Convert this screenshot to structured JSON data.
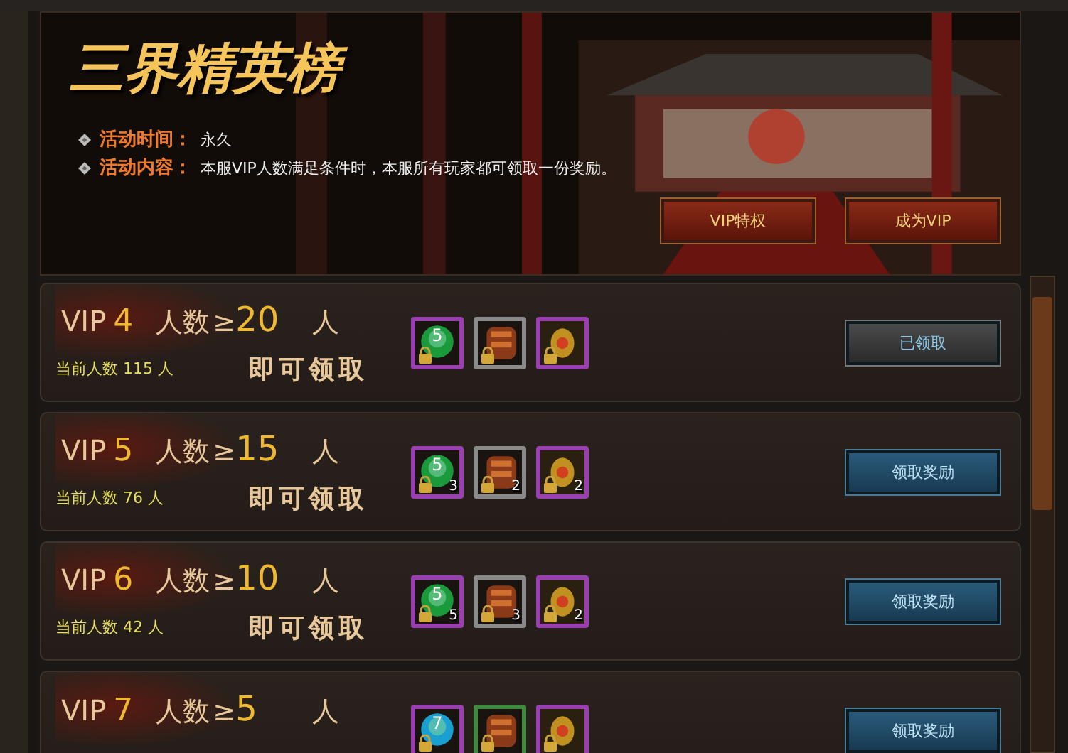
{
  "banner": {
    "title": "三界精英榜",
    "info": [
      {
        "label": "活动时间：",
        "value": "永久"
      },
      {
        "label": "活动内容：",
        "value": "本服VIP人数满足条件时，本服所有玩家都可领取一份奖励。"
      }
    ],
    "buttons": [
      "VIP特权",
      "成为VIP"
    ]
  },
  "tiers": [
    {
      "vip": "VIP",
      "level": "4",
      "people_label": "人数",
      "ge": "≥",
      "threshold": "20",
      "unit": "人",
      "current": "当前人数 115 人",
      "claim_hint": "即可领取",
      "button": "已领取",
      "claimed": true,
      "rewards": [
        {
          "kind": "orb",
          "orb_label": "5",
          "color": "#9a3fb0"
        },
        {
          "kind": "gauntlet",
          "color": "#8a8a8a"
        },
        {
          "kind": "lantern",
          "color": "#9a3fb0"
        }
      ]
    },
    {
      "vip": "VIP",
      "level": "5",
      "people_label": "人数",
      "ge": "≥",
      "threshold": "15",
      "unit": "人",
      "current": "当前人数 76 人",
      "claim_hint": "即可领取",
      "button": "领取奖励",
      "claimed": false,
      "rewards": [
        {
          "kind": "orb",
          "orb_label": "5",
          "count": "3",
          "color": "#9a3fb0"
        },
        {
          "kind": "gauntlet",
          "count": "2",
          "color": "#8a8a8a"
        },
        {
          "kind": "lantern",
          "count": "2",
          "color": "#9a3fb0"
        }
      ]
    },
    {
      "vip": "VIP",
      "level": "6",
      "people_label": "人数",
      "ge": "≥",
      "threshold": "10",
      "unit": "人",
      "current": "当前人数 42 人",
      "claim_hint": "即可领取",
      "button": "领取奖励",
      "claimed": false,
      "rewards": [
        {
          "kind": "orb",
          "orb_label": "5",
          "count": "5",
          "color": "#9a3fb0"
        },
        {
          "kind": "gauntlet",
          "count": "3",
          "color": "#8a8a8a"
        },
        {
          "kind": "lantern",
          "count": "2",
          "color": "#9a3fb0"
        }
      ]
    },
    {
      "vip": "VIP",
      "level": "7",
      "people_label": "人数",
      "ge": "≥",
      "threshold": "5",
      "unit": "人",
      "button": "领取奖励",
      "claimed": false,
      "rewards": [
        {
          "kind": "orb",
          "orb_label": "7",
          "color": "#9a3fb0"
        },
        {
          "kind": "gauntlet",
          "color": "#3f8a3f"
        },
        {
          "kind": "lantern",
          "color": "#9a3fb0"
        }
      ]
    }
  ]
}
